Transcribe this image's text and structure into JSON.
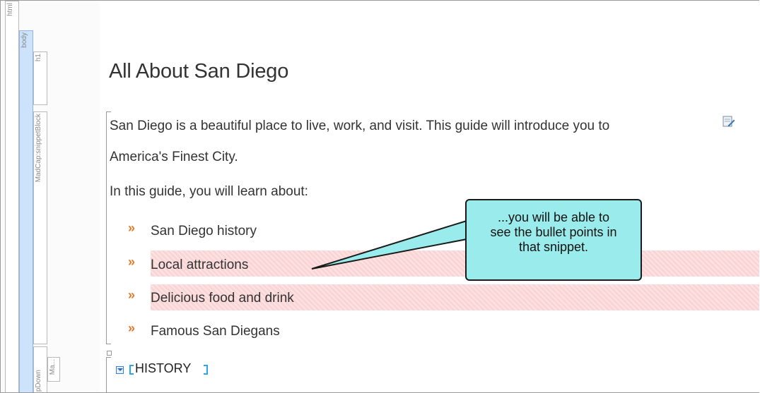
{
  "structure_bar": {
    "html_label": "html",
    "body_label": "body",
    "h1_label": "h1",
    "snippet_label": "MadCap:snippetBlock",
    "dropdown_label": "pDown",
    "madcap_label": "Ma..."
  },
  "document": {
    "heading": "All About San Diego",
    "paragraph_1": "San Diego is a beautiful place to live, work, and visit. This guide will introduce you to",
    "paragraph_1b": "America's Finest City.",
    "paragraph_2": "In this guide, you will learn about:",
    "bullets": [
      "San Diego history",
      "Local attractions",
      "Delicious food and drink",
      "Famous San Diegans"
    ],
    "bullet_icon": "chevron-double-right",
    "history_label": "HISTORY"
  },
  "callout": {
    "line1": "...you will be able to",
    "line2": "see the bullet points in",
    "line3": "that snippet."
  },
  "colors": {
    "highlight": "#fbd5d5",
    "callout_fill": "#9aecec",
    "bullet": "#e07b2c",
    "tag_marker": "#29a6e8"
  }
}
